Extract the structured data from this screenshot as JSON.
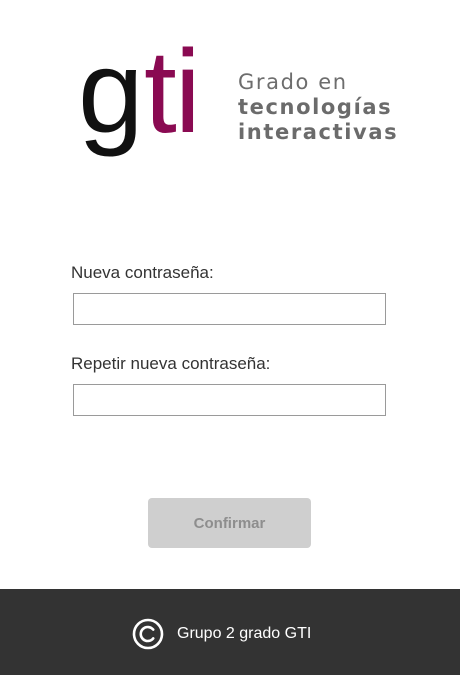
{
  "logo": {
    "mark_g": "g",
    "mark_ti": "ti",
    "line1": "Grado en",
    "line2": "tecnologías",
    "line3": "interactivas",
    "colors": {
      "g": "#111111",
      "ti": "#8a0a52",
      "text": "#6d6d6d"
    }
  },
  "form": {
    "new_password_label": "Nueva contraseña:",
    "new_password_value": "",
    "repeat_password_label": "Repetir nueva contraseña:",
    "repeat_password_value": "",
    "confirm_label": "Confirmar"
  },
  "footer": {
    "icon": "copyright-icon",
    "text": "Grupo 2 grado GTI",
    "background": "#333333"
  }
}
